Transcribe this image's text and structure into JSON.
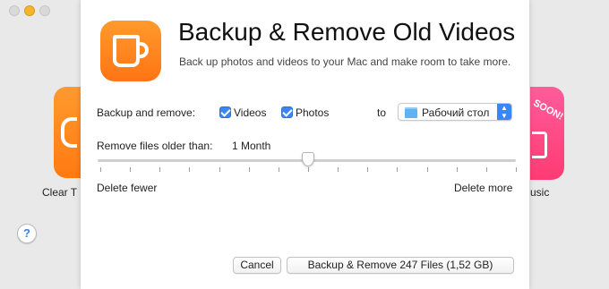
{
  "background": {
    "left_app_label": "Clear T",
    "right_app_label": "usic",
    "right_app_badge": "SOON!",
    "help_label": "?"
  },
  "dialog": {
    "title": "Backup & Remove Old Videos",
    "subtitle": "Back up photos and videos to your Mac and make room to take more.",
    "app_icon": "cup-icon",
    "backup_label": "Backup and remove:",
    "videos_label": "Videos",
    "videos_checked": true,
    "photos_label": "Photos",
    "photos_checked": true,
    "to_label": "to",
    "destination": {
      "value": "Рабочий стол",
      "icon": "folder-icon"
    },
    "remove_label": "Remove files older than:",
    "remove_value": "1 Month",
    "slider": {
      "min_label": "Delete fewer",
      "max_label": "Delete more",
      "value_fraction": 0.5,
      "tick_count": 15
    },
    "cancel_label": "Cancel",
    "primary_label": "Backup & Remove 247 Files (1,52 GB)"
  },
  "colors": {
    "accent": "#3b86f7",
    "app_icon_orange": "#ff8a1f",
    "window_yellow": "#f5b52c"
  }
}
